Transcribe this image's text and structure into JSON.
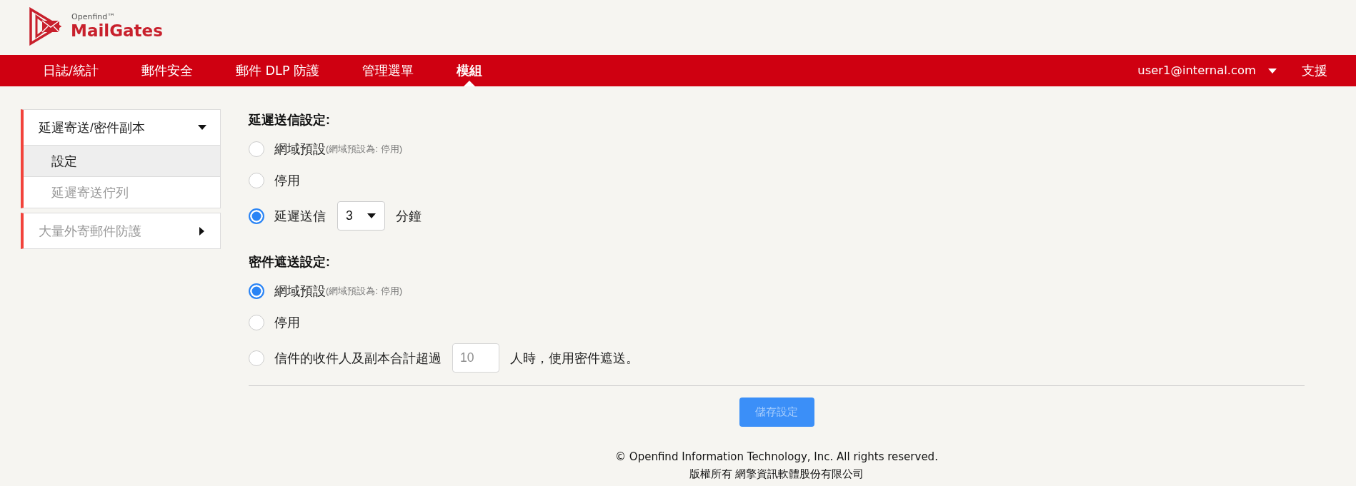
{
  "logo": {
    "subtitle": "Openfind™",
    "title": "MailGates"
  },
  "nav": {
    "items": [
      {
        "label": "日誌/統計",
        "selected": false
      },
      {
        "label": "郵件安全",
        "selected": false
      },
      {
        "label": "郵件 DLP 防護",
        "selected": false
      },
      {
        "label": "管理選單",
        "selected": false
      },
      {
        "label": "模組",
        "selected": true
      }
    ],
    "user": "user1@internal.com",
    "support": "支援"
  },
  "sidebar": {
    "groups": [
      {
        "label": "延遲寄送/密件副本",
        "expanded": true,
        "children": [
          {
            "label": "設定",
            "selected": true
          },
          {
            "label": "延遲寄送佇列",
            "selected": false
          }
        ]
      },
      {
        "label": "大量外寄郵件防護",
        "expanded": false
      }
    ]
  },
  "sections": [
    {
      "title": "延遲送信設定:",
      "options": [
        {
          "kind": "plain",
          "label": "網域預設",
          "note": "(網域預設為: 停用)",
          "selected": false
        },
        {
          "kind": "plain",
          "label": "停用",
          "selected": false
        },
        {
          "kind": "select",
          "label": "延遲送信",
          "value": "3",
          "suffix": "分鐘",
          "selected": true
        }
      ]
    },
    {
      "title": "密件遮送設定:",
      "options": [
        {
          "kind": "plain",
          "label": "網域預設",
          "note": "(網域預設為: 停用)",
          "selected": true
        },
        {
          "kind": "plain",
          "label": "停用",
          "selected": false
        },
        {
          "kind": "input",
          "label": "信件的收件人及副本合計超過",
          "value": "10",
          "disabled": true,
          "suffix": "人時，使用密件遮送。",
          "selected": false
        }
      ]
    }
  ],
  "save_button": {
    "label": "儲存設定",
    "disabled": true
  },
  "footer": {
    "copyright": "© Openfind Information Technology, Inc. All rights reserved.",
    "company": "版權所有 網擎資訊軟體股份有限公司"
  }
}
